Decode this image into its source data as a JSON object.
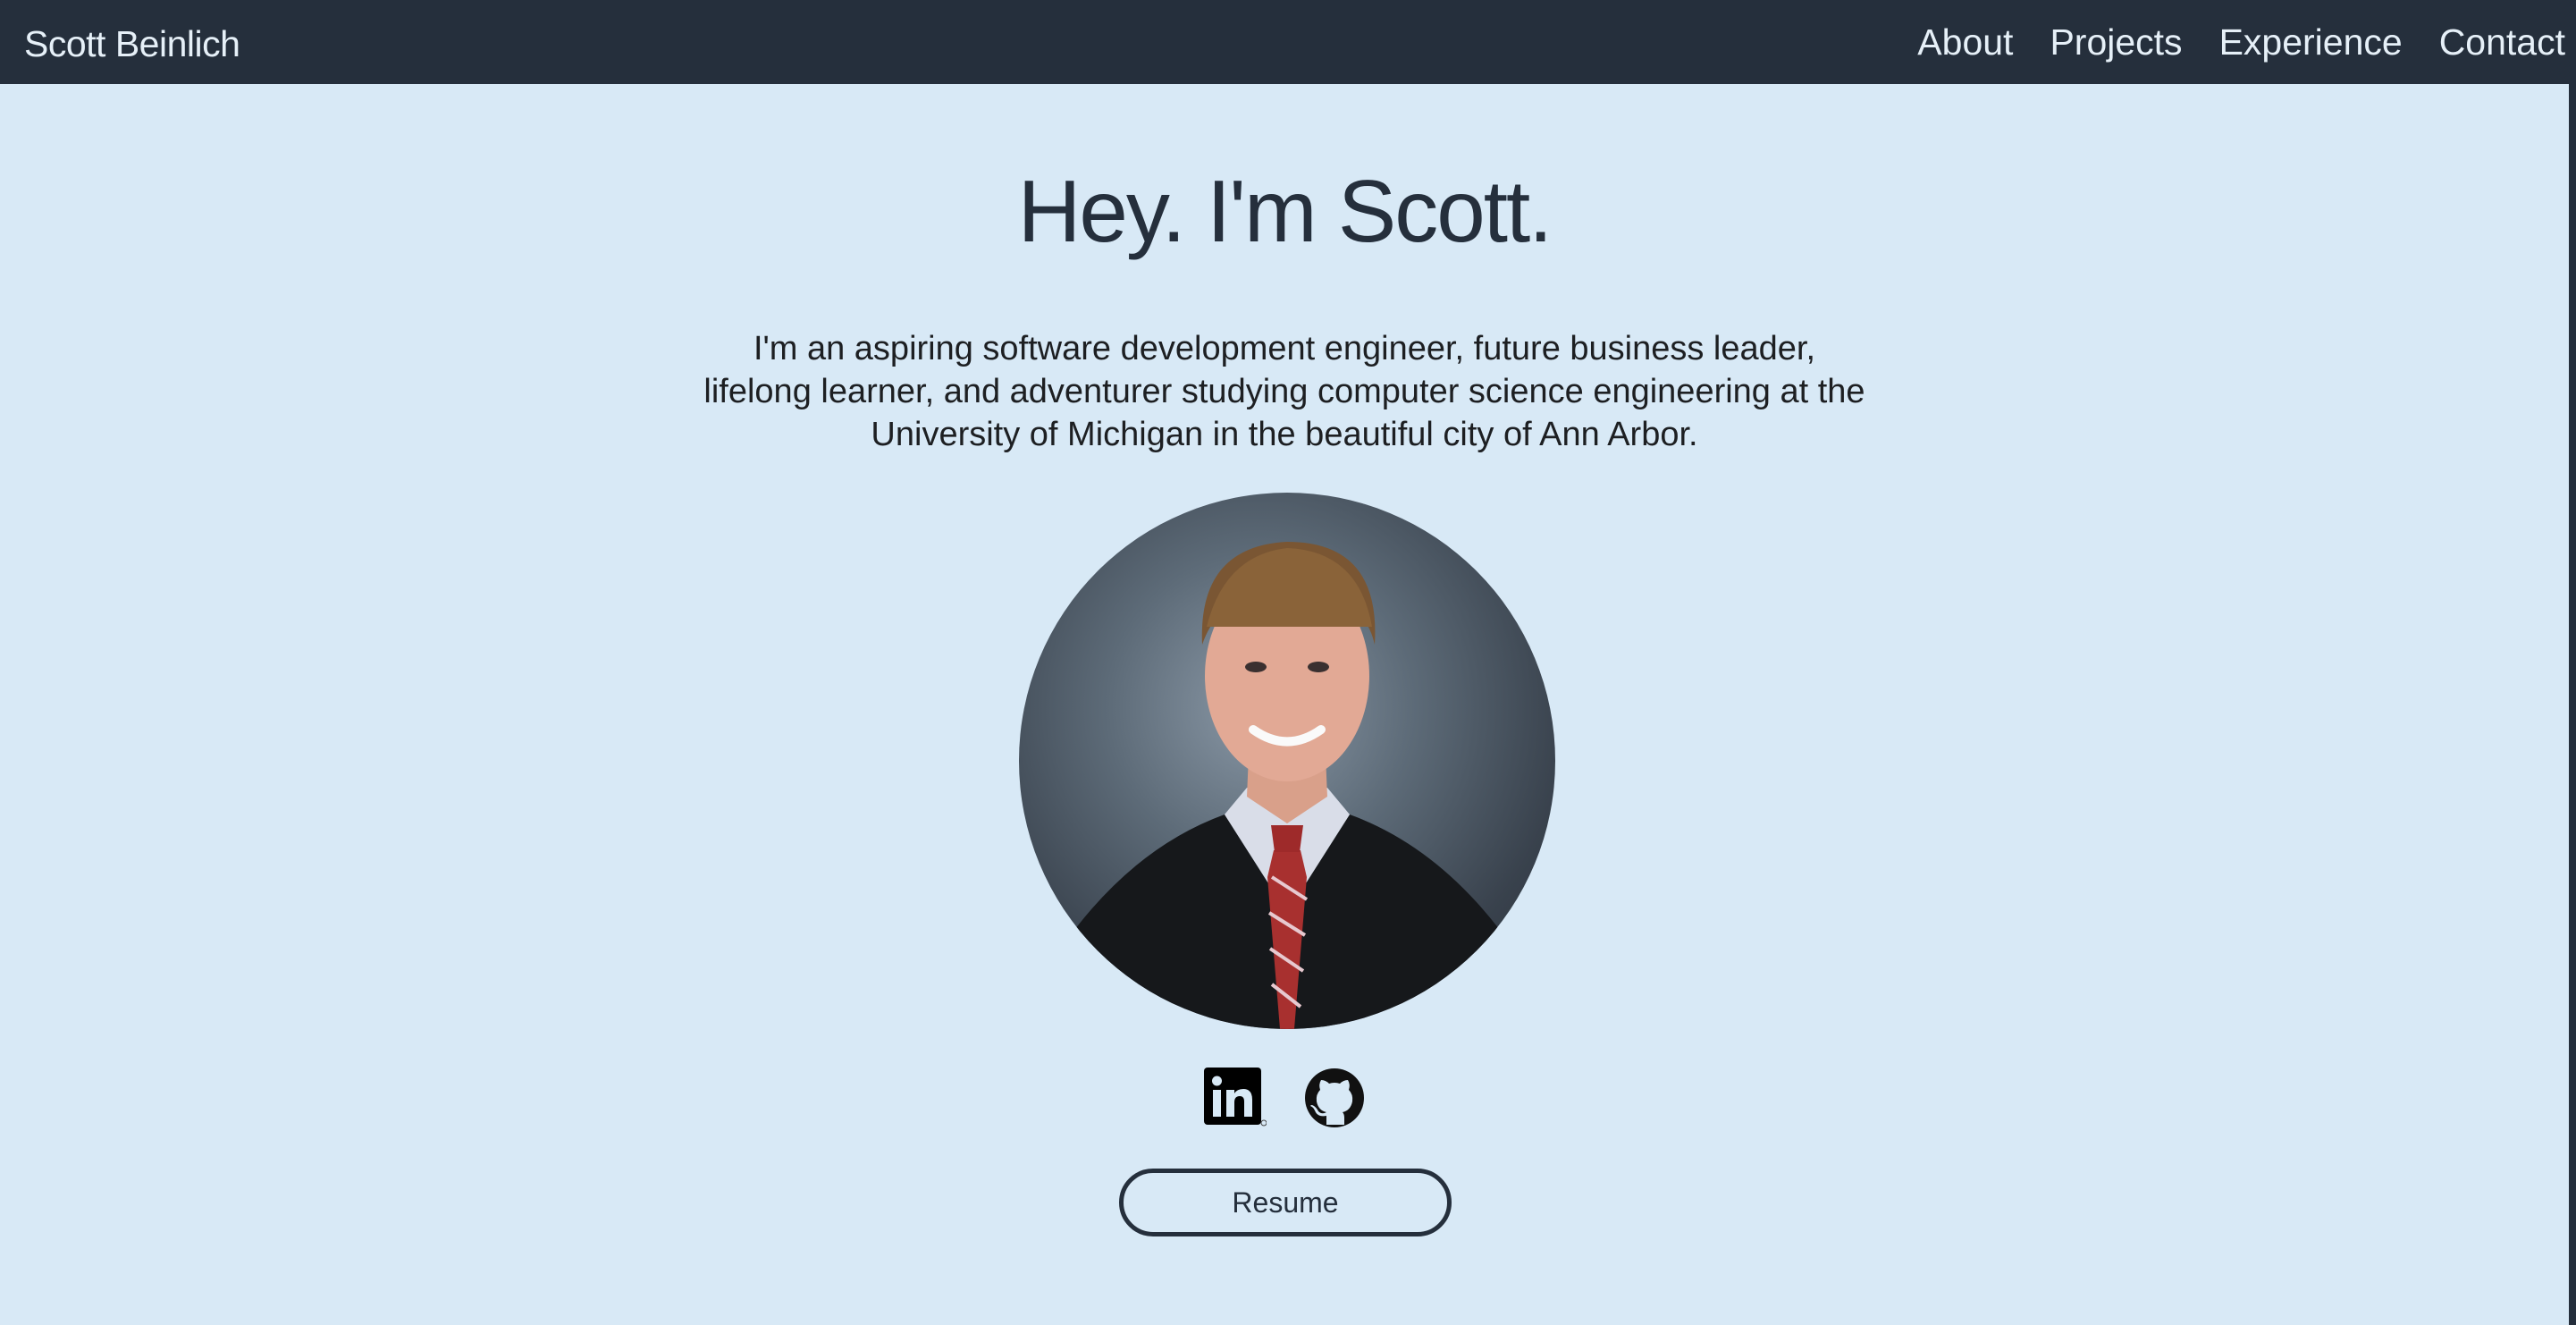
{
  "nav": {
    "brand": "Scott Beinlich",
    "links": [
      "About",
      "Projects",
      "Experience",
      "Contact"
    ]
  },
  "hero": {
    "title": "Hey. I'm Scott.",
    "bio": "I'm an aspiring software development engineer, future business leader, lifelong learner, and adventurer studying computer science engineering at the University of Michigan in the beautiful city of Ann Arbor."
  },
  "social": {
    "icons": [
      "linkedin-icon",
      "github-icon"
    ]
  },
  "resume_button": {
    "label": "Resume"
  },
  "colors": {
    "navbar": "#252f3c",
    "background": "#d8e9f6",
    "text_dark": "#252f3c"
  }
}
